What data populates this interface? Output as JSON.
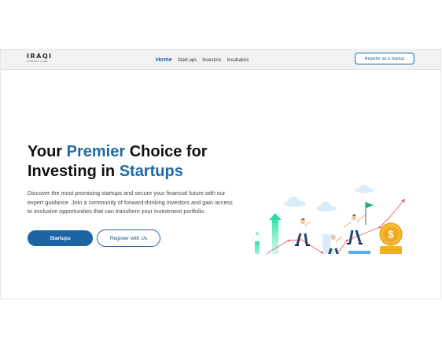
{
  "header": {
    "logo_text": "IRAQI",
    "logo_subtext": "STARTUP • HUB",
    "nav": [
      "Home",
      "Start-ups",
      "Investors",
      "Incubators"
    ],
    "register_button": "Register as a startup"
  },
  "hero": {
    "title_part1": "Your ",
    "title_accent1": "Premier",
    "title_part2": " Choice for",
    "title_part3": "Investing in ",
    "title_accent2": "Startups",
    "description": "Discover the most promising startups and secure your financial future with our expert guidance. Join a community of forward-thinking investors and gain access to exclusive opportunities that can transform your investment portfolio.",
    "primary_button": "Startups",
    "secondary_button": "Register with Us"
  },
  "illustration": {
    "coin_symbol": "$"
  },
  "colors": {
    "accent": "#1f6aa8",
    "primary_button": "#1d64a3",
    "coin": "#f3b324",
    "bar": "#4ea6e8",
    "arrow_green": "#2fd29a",
    "trend_line": "#ef5b6e"
  }
}
